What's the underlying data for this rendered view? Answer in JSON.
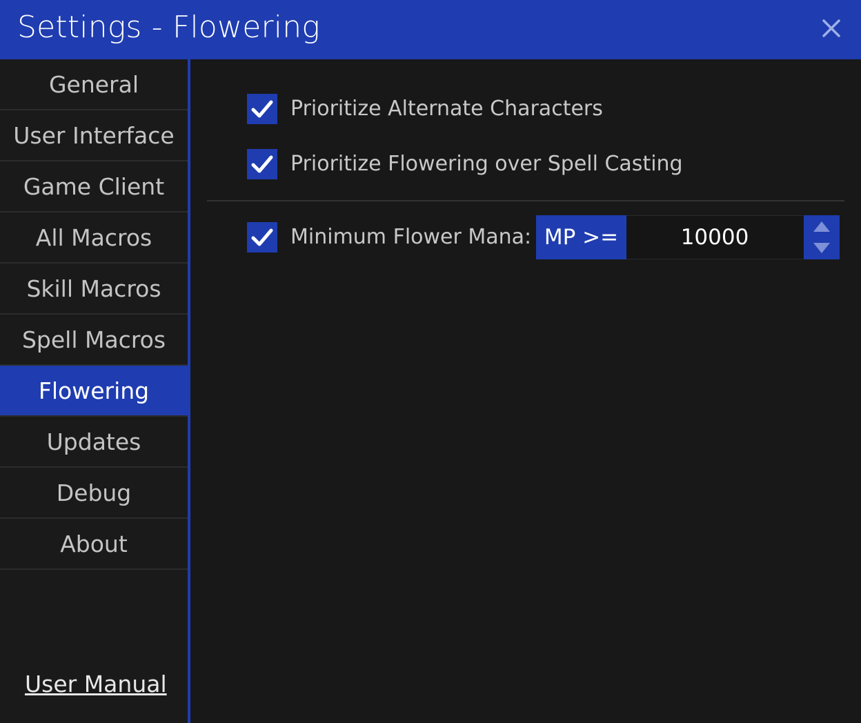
{
  "window": {
    "title": "Settings - Flowering",
    "close_icon": "close-icon"
  },
  "sidebar": {
    "items": [
      {
        "label": "General"
      },
      {
        "label": "User Interface"
      },
      {
        "label": "Game Client"
      },
      {
        "label": "All Macros"
      },
      {
        "label": "Skill Macros"
      },
      {
        "label": "Spell Macros"
      },
      {
        "label": "Flowering",
        "active": true
      },
      {
        "label": "Updates"
      },
      {
        "label": "Debug"
      },
      {
        "label": "About"
      }
    ],
    "user_manual_link": "User Manual"
  },
  "flowering": {
    "prioritize_alternate": {
      "label": "Prioritize Alternate Characters",
      "checked": true
    },
    "prioritize_flowering": {
      "label": "Prioritize Flowering over Spell Casting",
      "checked": true
    },
    "minimum_mana": {
      "label": "Minimum Flower Mana:",
      "checked": true,
      "prefix": "MP >=",
      "value": "10000"
    }
  },
  "colors": {
    "accent": "#1f3db0",
    "background": "#181818",
    "text": "#c8c8c8"
  }
}
